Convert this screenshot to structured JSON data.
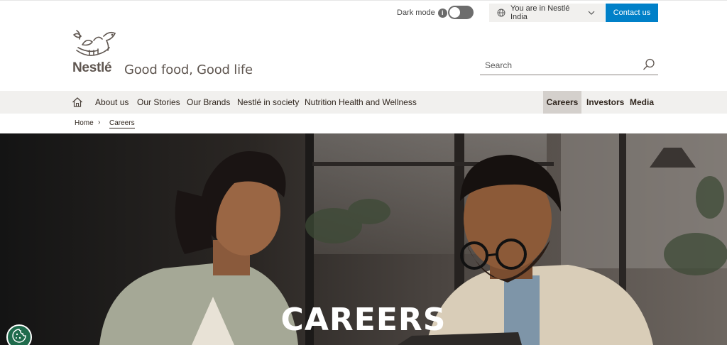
{
  "utility": {
    "dark_mode_label": "Dark mode",
    "info_glyph": "i",
    "dark_mode_on": false,
    "country_label": "You are in Nestlé India",
    "contact_label": "Contact us"
  },
  "brand": {
    "logo_text": "Nestlé",
    "tagline": "Good food, Good life"
  },
  "search": {
    "placeholder": "Search"
  },
  "nav": {
    "left": [
      "About us",
      "Our Stories",
      "Our Brands",
      "Nestlé in society",
      "Nutrition Health and Wellness"
    ],
    "right": [
      "Careers",
      "Investors",
      "Media"
    ],
    "active": "Careers"
  },
  "breadcrumb": {
    "home": "Home",
    "separator": "›",
    "current": "Careers"
  },
  "hero": {
    "title": "CAREERS"
  },
  "colors": {
    "accent": "#0080c8",
    "nav_bg": "#f1f0ee",
    "active_bg": "#d4d0cc",
    "text": "#30261e",
    "cookie": "#1f6b4c"
  },
  "icons": [
    "info-icon",
    "toggle-switch",
    "globe-icon",
    "chevron-down-icon",
    "nestle-nest-logo",
    "search-icon",
    "home-icon",
    "cookie-icon"
  ]
}
